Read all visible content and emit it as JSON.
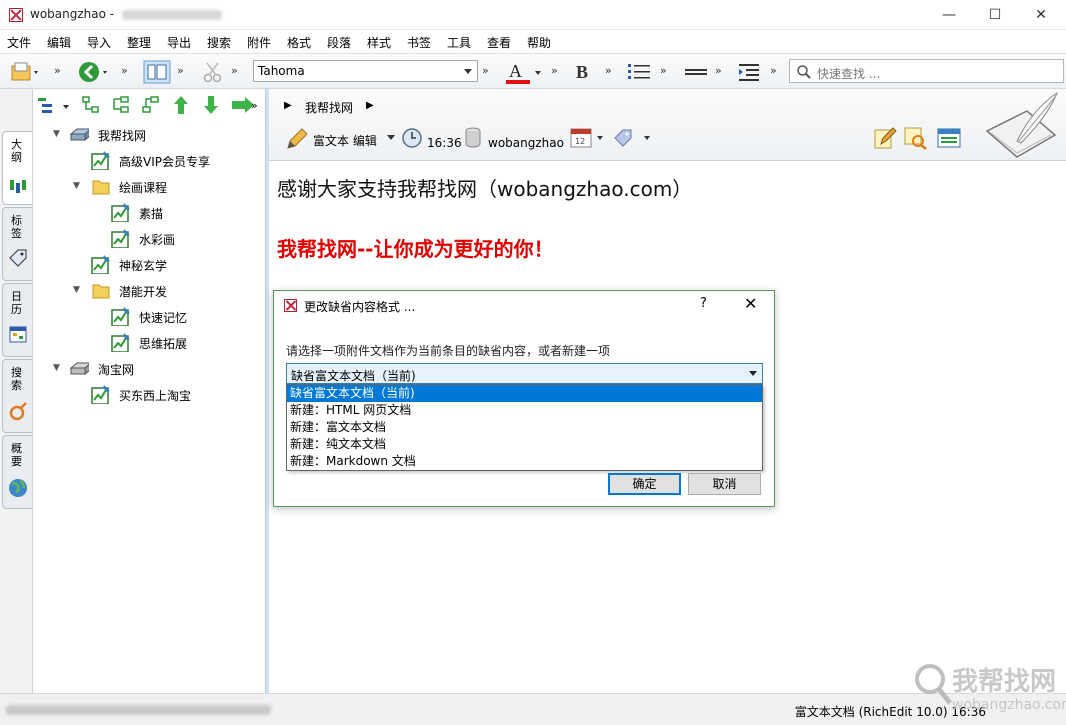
{
  "window": {
    "title": "wobangzhao - ",
    "controls": {
      "minimize": "—",
      "maximize": "☐",
      "close": "✕"
    }
  },
  "menu": [
    "文件",
    "编辑",
    "导入",
    "整理",
    "导出",
    "搜索",
    "附件",
    "格式",
    "段落",
    "样式",
    "书签",
    "工具",
    "查看",
    "帮助"
  ],
  "toolbar": {
    "font": "Tahoma",
    "search_placeholder": "快速查找 ...",
    "overflow": "»"
  },
  "side_tabs": [
    "大纲",
    "标签",
    "日历",
    "搜索",
    "概要"
  ],
  "tree": [
    {
      "label": "我帮找网",
      "level": 0,
      "expanded": true,
      "icon": "drive-icon"
    },
    {
      "label": "高级VIP会员专享",
      "level": 1,
      "icon": "document-icon"
    },
    {
      "label": "绘画课程",
      "level": 1,
      "expanded": true,
      "icon": "folder-icon"
    },
    {
      "label": "素描",
      "level": 2,
      "icon": "document-icon"
    },
    {
      "label": "水彩画",
      "level": 2,
      "icon": "document-icon"
    },
    {
      "label": "神秘玄学",
      "level": 1,
      "icon": "document-icon"
    },
    {
      "label": "潜能开发",
      "level": 1,
      "expanded": true,
      "icon": "folder-icon"
    },
    {
      "label": "快速记忆",
      "level": 2,
      "icon": "document-icon"
    },
    {
      "label": "思维拓展",
      "level": 2,
      "icon": "document-icon"
    },
    {
      "label": "淘宝网",
      "level": 0,
      "expanded": true,
      "icon": "drive-icon"
    },
    {
      "label": "买东西上淘宝",
      "level": 1,
      "icon": "document-icon"
    }
  ],
  "doc": {
    "breadcrumb": "我帮找网",
    "format_label": "富文本 编辑",
    "time": "16:36",
    "author": "wobangzhao",
    "headline": "感谢大家支持我帮找网（wobangzhao.com）",
    "slogan": "我帮找网--让你成为更好的你！"
  },
  "dialog": {
    "title": "更改缺省内容格式 ...",
    "help": "?",
    "close": "✕",
    "prompt": "请选择一项附件文档作为当前条目的缺省内容，或者新建一项",
    "selected": "缺省富文本文档（当前)",
    "options": [
      "缺省富文本文档（当前)",
      "新建：HTML 网页文档",
      "新建：富文本文档",
      "新建：纯文本文档",
      "新建：Markdown 文档"
    ],
    "ok": "确定",
    "cancel": "取消"
  },
  "status": {
    "right": "富文本文档 (RichEdit 10.0) 16:36"
  },
  "watermark": {
    "text": "我帮找网",
    "sub": "wobangzhao.com"
  },
  "colors": {
    "slogan": "#e00000",
    "selection": "#0078d7",
    "dialog_border": "#5b9a5b"
  }
}
